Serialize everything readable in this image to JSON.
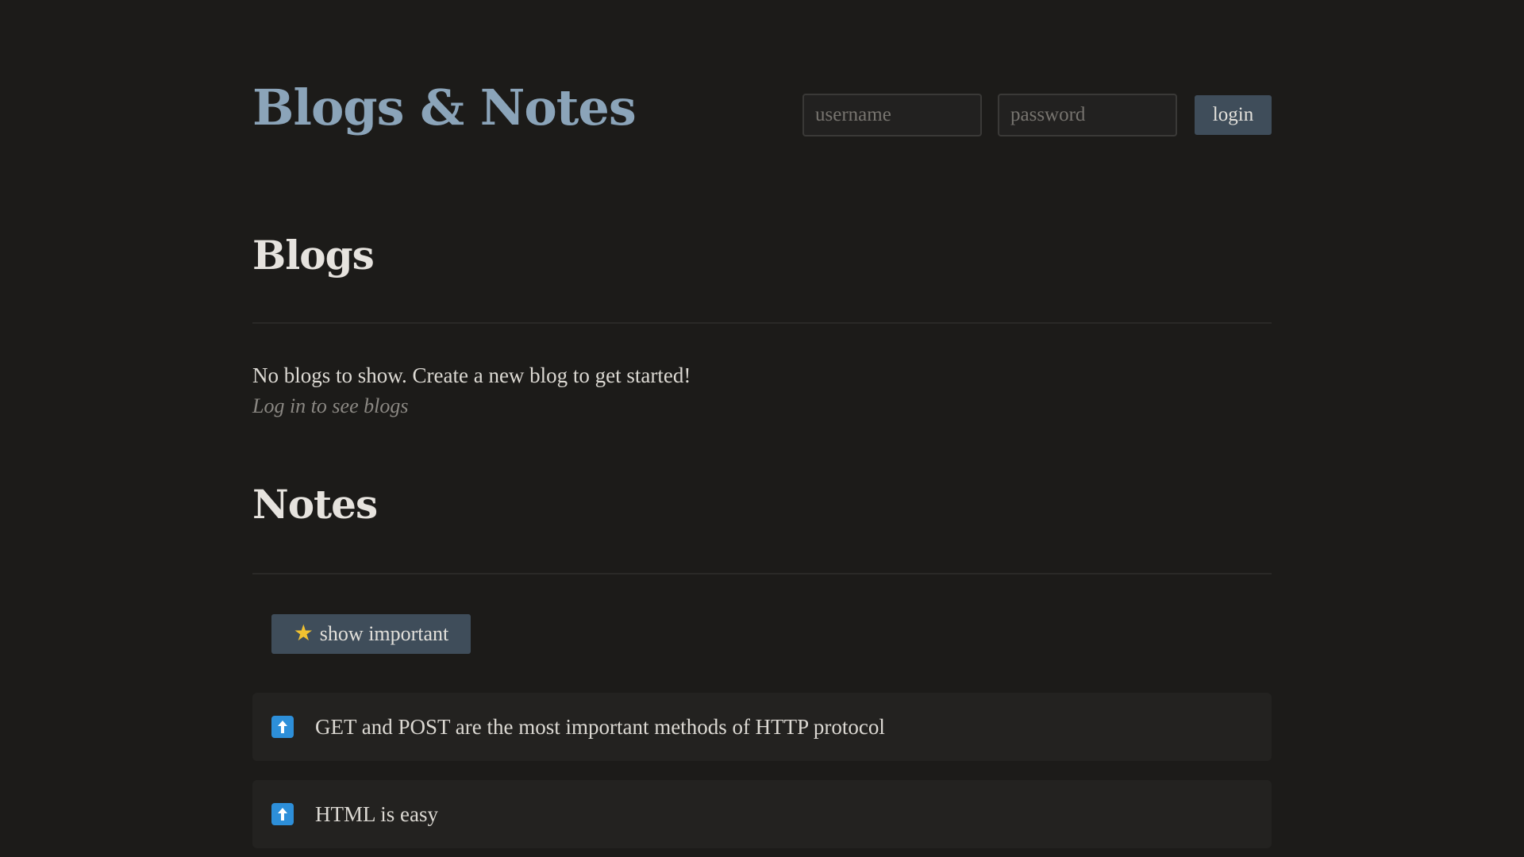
{
  "header": {
    "title": "Blogs & Notes",
    "login": {
      "username_placeholder": "username",
      "password_placeholder": "password",
      "button_label": "login"
    }
  },
  "blogs": {
    "heading": "Blogs",
    "empty_message": "No blogs to show. Create a new blog to get started!",
    "login_hint": "Log in to see blogs"
  },
  "notes": {
    "heading": "Notes",
    "filter_button": {
      "icon": "star-icon",
      "label": "show important"
    },
    "items": [
      {
        "icon": "arrow-up-icon",
        "text": "GET and POST are the most important methods of HTTP protocol"
      },
      {
        "icon": "arrow-up-icon",
        "text": "HTML is easy"
      }
    ]
  },
  "colors": {
    "background": "#1c1b19",
    "title": "#8ba4b9",
    "button": "#3f4d5a",
    "note_background": "#232220",
    "upvote_icon": "#2d8fd9",
    "star": "#f2c230"
  }
}
